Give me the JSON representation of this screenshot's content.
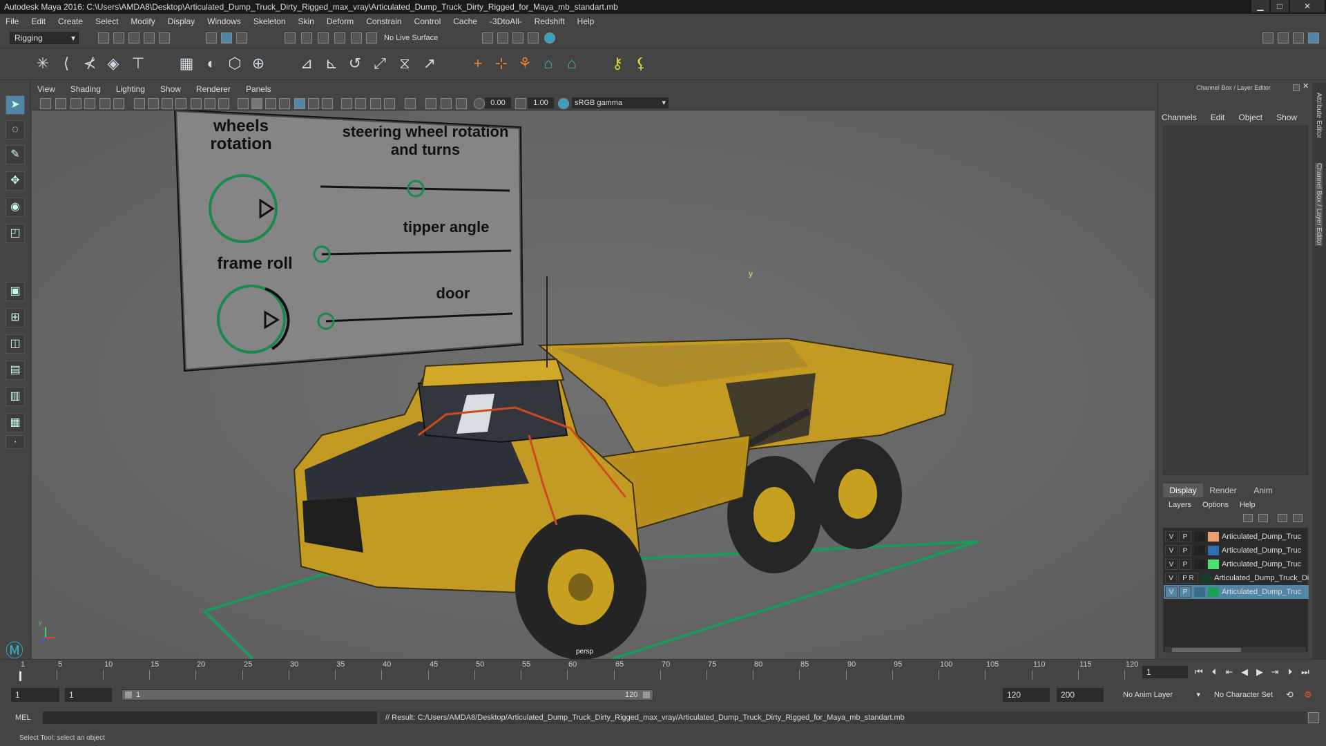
{
  "window": {
    "title": "Autodesk Maya 2016: C:\\Users\\AMDA8\\Desktop\\Articulated_Dump_Truck_Dirty_Rigged_max_vray\\Articulated_Dump_Truck_Dirty_Rigged_for_Maya_mb_standart.mb",
    "minimize": "▁",
    "maximize": "□",
    "close": "✕"
  },
  "menubar": [
    "File",
    "Edit",
    "Create",
    "Select",
    "Modify",
    "Display",
    "Windows",
    "Skeleton",
    "Skin",
    "Deform",
    "Constrain",
    "Control",
    "Cache",
    "-3DtoAll-",
    "Redshift",
    "Help"
  ],
  "status_line": {
    "mode": "Rigging",
    "live_surface": "No Live Surface"
  },
  "viewport": {
    "menu": [
      "View",
      "Shading",
      "Lighting",
      "Show",
      "Renderer",
      "Panels"
    ],
    "near_value": "0.00",
    "far_value": "1.00",
    "color_space": "sRGB gamma",
    "camera_label": "persp",
    "axis_y": "y"
  },
  "rig_board": {
    "wheels_rotation": "wheels\nrotation",
    "steering": "steering wheel rotation\nand turns",
    "tipper": "tipper angle",
    "frame_roll": "frame roll",
    "door": "door"
  },
  "channel_box": {
    "title": "Channel Box / Layer Editor",
    "menu": [
      "Channels",
      "Edit",
      "Object",
      "Show"
    ],
    "side_tabs": [
      "Attribute Editor",
      "Channel Box / Layer Editor"
    ]
  },
  "layer_editor": {
    "tabs": [
      "Display",
      "Render",
      "Anim"
    ],
    "active_tab": "Display",
    "menu": [
      "Layers",
      "Options",
      "Help"
    ],
    "layers": [
      {
        "v": "V",
        "p": "P",
        "name": "Articulated_Dump_Truc",
        "color": "#e8a070",
        "selected": false
      },
      {
        "v": "V",
        "p": "P",
        "name": "Articulated_Dump_Truc",
        "color": "#2f6fb0",
        "selected": false
      },
      {
        "v": "V",
        "p": "P",
        "name": "Articulated_Dump_Truc",
        "color": "#50e070",
        "selected": false
      },
      {
        "v": "V",
        "p": "P R",
        "name": "Articulated_Dump_Truck_Dirt",
        "color": "#1a3a2a",
        "selected": false
      },
      {
        "v": "V",
        "p": "P",
        "name": "Articulated_Dump_Truc",
        "color": "#1aa050",
        "selected": true
      }
    ]
  },
  "timeline": {
    "ticks": [
      "1",
      "5",
      "10",
      "15",
      "20",
      "25",
      "30",
      "35",
      "40",
      "45",
      "50",
      "55",
      "60",
      "65",
      "70",
      "75",
      "80",
      "85",
      "90",
      "95",
      "100",
      "105",
      "110",
      "115",
      "120"
    ],
    "current_frame": "1"
  },
  "range": {
    "start": "1",
    "playback_start": "1",
    "slider_start": "1",
    "slider_end": "120",
    "playback_end": "120",
    "end": "200",
    "anim_layer": "No Anim Layer",
    "character_set": "No Character Set"
  },
  "command_line": {
    "language": "MEL",
    "result": "// Result: C:/Users/AMDA8/Desktop/Articulated_Dump_Truck_Dirty_Rigged_max_vray/Articulated_Dump_Truck_Dirty_Rigged_for_Maya_mb_standart.mb"
  },
  "status_help": "Select Tool: select an object"
}
